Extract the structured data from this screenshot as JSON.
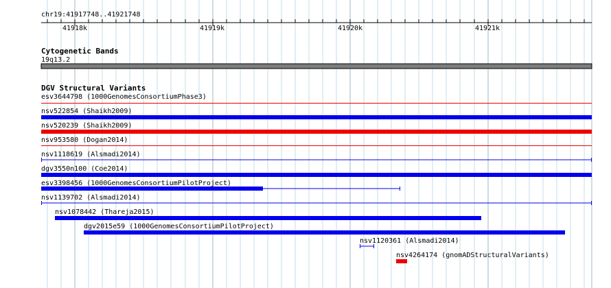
{
  "ruler": {
    "location": "chr19:41917748..41921748",
    "ticks": [
      "41918k",
      "41919k",
      "41920k",
      "41921k"
    ]
  },
  "colors": {
    "grid": "#c6dce8",
    "grid_major": "#9fb7c4",
    "band": "#7d7d7d",
    "gain": "#0000ee",
    "loss": "#ee0000",
    "text": "#000000"
  },
  "tracks": {
    "cytoband": {
      "title": "Cytogenetic Bands",
      "band_label": "19q13.2"
    },
    "dgv": {
      "title": "DGV Structural Variants",
      "features": [
        {
          "label": "esv3644798 (1000GenomesConsortiumPhase3)",
          "kind": "loss",
          "style": "thin"
        },
        {
          "label": "nsv522854 (Shaikh2009)",
          "kind": "gain",
          "style": "thick"
        },
        {
          "label": "nsv520239 (Shaikh2009)",
          "kind": "loss",
          "style": "thick"
        },
        {
          "label": "nsv953580 (Dogan2014)",
          "kind": "loss",
          "style": "thin"
        },
        {
          "label": "nsv1118619 (Alsmadi2014)",
          "kind": "gain",
          "style": "whisker"
        },
        {
          "label": "dgv3550n100 (Coe2014)",
          "kind": "gain",
          "style": "thick"
        },
        {
          "label": "esv3398456 (1000GenomesConsortiumPilotProject)",
          "kind": "gain",
          "style": "partial"
        },
        {
          "label": "nsv1139702 (Alsmadi2014)",
          "kind": "gain",
          "style": "whisker"
        },
        {
          "label": "nsv1078442 (Thareja2015)",
          "kind": "gain",
          "style": "thick"
        },
        {
          "label": "dgv2015e59 (1000GenomesConsortiumPilotProject)",
          "kind": "gain",
          "style": "thick"
        },
        {
          "label": "nsv1120361 (Alsmadi2014)",
          "kind": "gain",
          "style": "whisker"
        },
        {
          "label": "nsv4264174 (gnomADStructuralVariants)",
          "kind": "loss",
          "style": "thick"
        }
      ]
    }
  }
}
